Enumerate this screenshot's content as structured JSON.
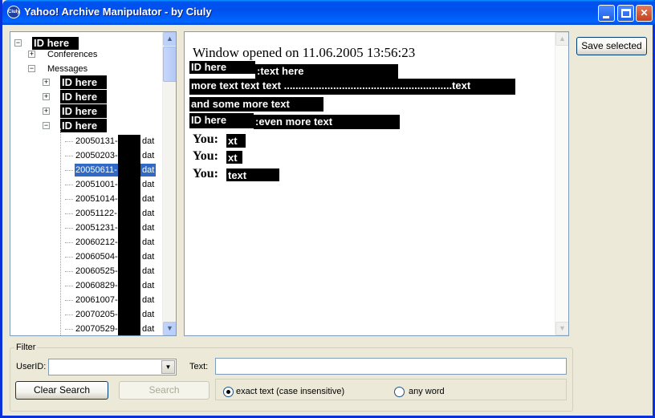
{
  "window": {
    "title": "Yahoo! Archive Manipulator - by Ciuly",
    "icon_text": "Ciuly"
  },
  "tree": {
    "root_label": "ID here",
    "conferences_label": "Conferences",
    "messages_label": "Messages",
    "id_nodes": [
      "ID here",
      "ID here",
      "ID here",
      "ID here"
    ],
    "files": [
      {
        "date": "20050131-",
        "ext": "dat"
      },
      {
        "date": "20050203-",
        "ext": "dat"
      },
      {
        "date": "20050611-",
        "ext": "dat"
      },
      {
        "date": "20051001-",
        "ext": "dat"
      },
      {
        "date": "20051014-",
        "ext": "dat"
      },
      {
        "date": "20051122-",
        "ext": "dat"
      },
      {
        "date": "20051231-",
        "ext": "dat"
      },
      {
        "date": "20060212-",
        "ext": "dat"
      },
      {
        "date": "20060504-",
        "ext": "dat"
      },
      {
        "date": "20060525-",
        "ext": "dat"
      },
      {
        "date": "20060829-",
        "ext": "dat"
      },
      {
        "date": "20061007-",
        "ext": "dat"
      },
      {
        "date": "20070205-",
        "ext": "dat"
      },
      {
        "date": "20070529-",
        "ext": "dat"
      }
    ],
    "selected_index": 2
  },
  "log": {
    "header": "Window opened on 11.06.2005 13:56:23",
    "id1": "ID here",
    "msg1": ":text here",
    "msg2": "more text text text ..........................................................text",
    "msg3": "and some more text",
    "id2": "ID here",
    "msg4": ":even more text",
    "you_label": "You:",
    "you_msgs": [
      "xt",
      "xt",
      "text"
    ]
  },
  "actions": {
    "save_selected": "Save selected"
  },
  "filter": {
    "group_label": "Filter",
    "userid_label": "UserID:",
    "userid_value": "",
    "text_label": "Text:",
    "text_value": "",
    "clear_search": "Clear Search",
    "search": "Search",
    "radio_exact": "exact text (case insensitive)",
    "radio_any": "any word",
    "selected_mode": "exact"
  },
  "colors": {
    "title_bar": "#0054e3",
    "selection": "#316ac5",
    "redaction": "#000000"
  }
}
